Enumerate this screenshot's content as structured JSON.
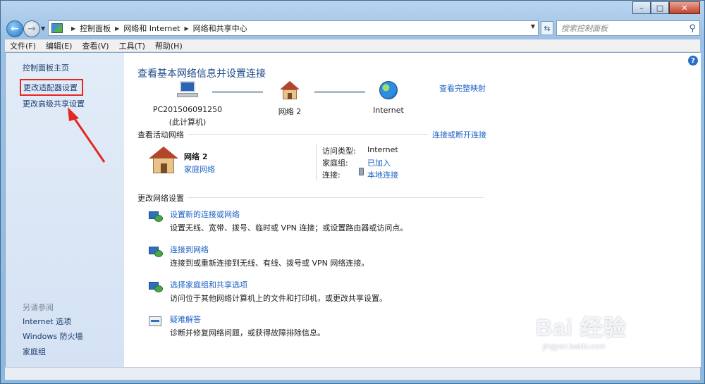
{
  "address_bar": {
    "breadcrumbs": [
      "控制面板",
      "网络和 Internet",
      "网络和共享中心"
    ],
    "search_placeholder": "搜索控制面板"
  },
  "menu": [
    "文件(F)",
    "编辑(E)",
    "查看(V)",
    "工具(T)",
    "帮助(H)"
  ],
  "sidebar": {
    "links": [
      "控制面板主页",
      "更改适配器设置",
      "更改高级共享设置"
    ],
    "see_also_title": "另请参阅",
    "see_also": [
      "Internet 选项",
      "Windows 防火墙",
      "家庭组"
    ]
  },
  "main": {
    "title": "查看基本网络信息并设置连接",
    "map_link": "查看完整映射",
    "map": {
      "computer": "PC201506091250",
      "computer_sub": "(此计算机)",
      "network": "网络  2",
      "internet": "Internet"
    },
    "active": {
      "header": "查看活动网络",
      "link": "连接或断开连接",
      "network_name": "网络  2",
      "network_type": "家庭网络",
      "access_label": "访问类型:",
      "access_value": "Internet",
      "homegroup_label": "家庭组:",
      "homegroup_value": "已加入",
      "connection_label": "连接:",
      "connection_value": "本地连接"
    },
    "change": {
      "header": "更改网络设置",
      "tasks": [
        {
          "link": "设置新的连接或网络",
          "desc": "设置无线、宽带、拨号、临时或 VPN 连接；或设置路由器或访问点。"
        },
        {
          "link": "连接到网络",
          "desc": "连接到或重新连接到无线、有线、拨号或 VPN 网络连接。"
        },
        {
          "link": "选择家庭组和共享选项",
          "desc": "访问位于其他网络计算机上的文件和打印机，或更改共享设置。"
        },
        {
          "link": "疑难解答",
          "desc": "诊断并修复网络问题，或获得故障排除信息。"
        }
      ]
    }
  },
  "watermark": {
    "main": "Bai 经验",
    "sub": "jingyan.baidu.com"
  },
  "colors": {
    "link": "#1c62c4",
    "highlight_box": "#e5271f",
    "title": "#1d4a8a"
  }
}
